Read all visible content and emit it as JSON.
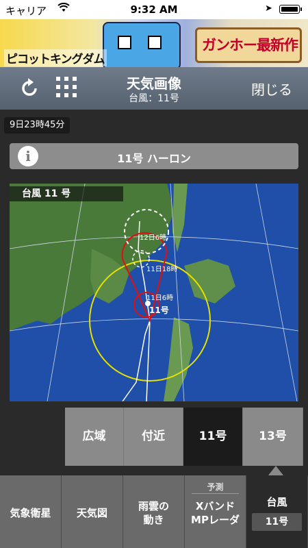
{
  "status": {
    "carrier": "キャリア",
    "time": "9:32 AM"
  },
  "ad": {
    "left_text": "ピコットキングダム",
    "right_text": "ガンホー最新作"
  },
  "nav": {
    "title": "天気画像",
    "subtitle": "台風：11号",
    "close": "閉じる"
  },
  "timestamp": "9日23時45分",
  "info": {
    "icon_letter": "i",
    "label": "11号 ハーロン"
  },
  "map": {
    "title": "台風 11 号",
    "labels": {
      "a": "12日6時",
      "b": "11日18時",
      "c": "11日6時",
      "d": "11号"
    }
  },
  "tabs": [
    {
      "label": "広域"
    },
    {
      "label": "付近"
    },
    {
      "label": "11号"
    },
    {
      "label": "13号"
    }
  ],
  "bottom": [
    {
      "label1": "気象衛星"
    },
    {
      "label1": "天気図"
    },
    {
      "label1": "雨雲の",
      "label2": "動き"
    },
    {
      "small": "予測",
      "label1": "Xバンド",
      "label2": "MPレーダ"
    },
    {
      "label1": "台風",
      "badge": "11号"
    }
  ],
  "colors": {
    "nav": "#5e6977",
    "active_tab": "#1b1b1b",
    "tab": "#8a8a8a",
    "track_red": "#e01010",
    "circle_yellow": "#e6e000",
    "sea": "#1f4fa8"
  }
}
